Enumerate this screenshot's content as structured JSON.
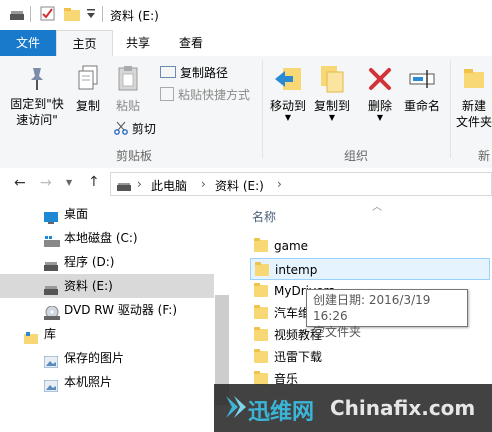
{
  "window": {
    "title": "资料 (E:)"
  },
  "ribbon_tabs": [
    {
      "label": "文件"
    },
    {
      "label": "主页"
    },
    {
      "label": "共享"
    },
    {
      "label": "查看"
    }
  ],
  "ribbon": {
    "pin_label_line1": "固定到\"快",
    "pin_label_line2": "速访问\"",
    "copy_label": "复制",
    "paste_label": "粘贴",
    "copy_path_label": "复制路径",
    "paste_shortcut_label": "粘贴快捷方式",
    "cut_label": "剪切",
    "clipboard_group": "剪贴板",
    "move_to_label": "移动到",
    "copy_to_label": "复制到",
    "delete_label": "删除",
    "rename_label": "重命名",
    "organize_group": "组织",
    "new_folder_line1": "新建",
    "new_folder_line2": "文件夹",
    "new_group_partial": "新"
  },
  "address": {
    "crumbs": [
      "此电脑",
      "资料 (E:)"
    ]
  },
  "sidebar": {
    "items": [
      {
        "label": "桌面"
      },
      {
        "label": "本地磁盘 (C:)"
      },
      {
        "label": "程序 (D:)"
      },
      {
        "label": "资料 (E:)"
      },
      {
        "label": "DVD RW 驱动器 (F:)"
      },
      {
        "label": "库"
      },
      {
        "label": "保存的图片"
      },
      {
        "label": "本机照片"
      }
    ]
  },
  "file_list": {
    "column_name": "名称",
    "items": [
      {
        "name": "game"
      },
      {
        "name": "intemp"
      },
      {
        "name": "MyDrivers"
      },
      {
        "name": "汽车维"
      },
      {
        "name": "视频教程"
      },
      {
        "name": "迅雷下载"
      },
      {
        "name": "音乐"
      }
    ]
  },
  "tooltip": {
    "line1": "创建日期: 2016/3/19 16:26",
    "line2": "空文件夹"
  },
  "watermark": {
    "brand": "迅维网",
    "site": "Chinafix.com"
  },
  "colors": {
    "file_tab": "#1979ca",
    "folder": "#f8d775",
    "delete_red": "#d13438",
    "selection": "#d9d9d9",
    "hover": "#e5f3ff"
  }
}
